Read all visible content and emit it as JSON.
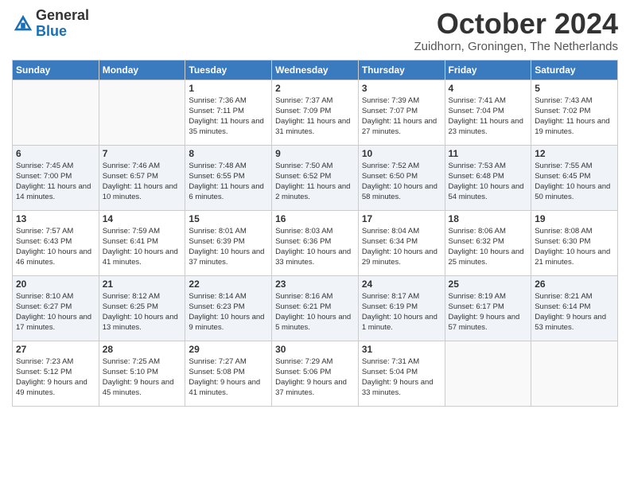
{
  "logo": {
    "general": "General",
    "blue": "Blue"
  },
  "title": "October 2024",
  "subtitle": "Zuidhorn, Groningen, The Netherlands",
  "days_of_week": [
    "Sunday",
    "Monday",
    "Tuesday",
    "Wednesday",
    "Thursday",
    "Friday",
    "Saturday"
  ],
  "weeks": [
    [
      {
        "day": "",
        "info": ""
      },
      {
        "day": "",
        "info": ""
      },
      {
        "day": "1",
        "info": "Sunrise: 7:36 AM\nSunset: 7:11 PM\nDaylight: 11 hours and 35 minutes."
      },
      {
        "day": "2",
        "info": "Sunrise: 7:37 AM\nSunset: 7:09 PM\nDaylight: 11 hours and 31 minutes."
      },
      {
        "day": "3",
        "info": "Sunrise: 7:39 AM\nSunset: 7:07 PM\nDaylight: 11 hours and 27 minutes."
      },
      {
        "day": "4",
        "info": "Sunrise: 7:41 AM\nSunset: 7:04 PM\nDaylight: 11 hours and 23 minutes."
      },
      {
        "day": "5",
        "info": "Sunrise: 7:43 AM\nSunset: 7:02 PM\nDaylight: 11 hours and 19 minutes."
      }
    ],
    [
      {
        "day": "6",
        "info": "Sunrise: 7:45 AM\nSunset: 7:00 PM\nDaylight: 11 hours and 14 minutes."
      },
      {
        "day": "7",
        "info": "Sunrise: 7:46 AM\nSunset: 6:57 PM\nDaylight: 11 hours and 10 minutes."
      },
      {
        "day": "8",
        "info": "Sunrise: 7:48 AM\nSunset: 6:55 PM\nDaylight: 11 hours and 6 minutes."
      },
      {
        "day": "9",
        "info": "Sunrise: 7:50 AM\nSunset: 6:52 PM\nDaylight: 11 hours and 2 minutes."
      },
      {
        "day": "10",
        "info": "Sunrise: 7:52 AM\nSunset: 6:50 PM\nDaylight: 10 hours and 58 minutes."
      },
      {
        "day": "11",
        "info": "Sunrise: 7:53 AM\nSunset: 6:48 PM\nDaylight: 10 hours and 54 minutes."
      },
      {
        "day": "12",
        "info": "Sunrise: 7:55 AM\nSunset: 6:45 PM\nDaylight: 10 hours and 50 minutes."
      }
    ],
    [
      {
        "day": "13",
        "info": "Sunrise: 7:57 AM\nSunset: 6:43 PM\nDaylight: 10 hours and 46 minutes."
      },
      {
        "day": "14",
        "info": "Sunrise: 7:59 AM\nSunset: 6:41 PM\nDaylight: 10 hours and 41 minutes."
      },
      {
        "day": "15",
        "info": "Sunrise: 8:01 AM\nSunset: 6:39 PM\nDaylight: 10 hours and 37 minutes."
      },
      {
        "day": "16",
        "info": "Sunrise: 8:03 AM\nSunset: 6:36 PM\nDaylight: 10 hours and 33 minutes."
      },
      {
        "day": "17",
        "info": "Sunrise: 8:04 AM\nSunset: 6:34 PM\nDaylight: 10 hours and 29 minutes."
      },
      {
        "day": "18",
        "info": "Sunrise: 8:06 AM\nSunset: 6:32 PM\nDaylight: 10 hours and 25 minutes."
      },
      {
        "day": "19",
        "info": "Sunrise: 8:08 AM\nSunset: 6:30 PM\nDaylight: 10 hours and 21 minutes."
      }
    ],
    [
      {
        "day": "20",
        "info": "Sunrise: 8:10 AM\nSunset: 6:27 PM\nDaylight: 10 hours and 17 minutes."
      },
      {
        "day": "21",
        "info": "Sunrise: 8:12 AM\nSunset: 6:25 PM\nDaylight: 10 hours and 13 minutes."
      },
      {
        "day": "22",
        "info": "Sunrise: 8:14 AM\nSunset: 6:23 PM\nDaylight: 10 hours and 9 minutes."
      },
      {
        "day": "23",
        "info": "Sunrise: 8:16 AM\nSunset: 6:21 PM\nDaylight: 10 hours and 5 minutes."
      },
      {
        "day": "24",
        "info": "Sunrise: 8:17 AM\nSunset: 6:19 PM\nDaylight: 10 hours and 1 minute."
      },
      {
        "day": "25",
        "info": "Sunrise: 8:19 AM\nSunset: 6:17 PM\nDaylight: 9 hours and 57 minutes."
      },
      {
        "day": "26",
        "info": "Sunrise: 8:21 AM\nSunset: 6:14 PM\nDaylight: 9 hours and 53 minutes."
      }
    ],
    [
      {
        "day": "27",
        "info": "Sunrise: 7:23 AM\nSunset: 5:12 PM\nDaylight: 9 hours and 49 minutes."
      },
      {
        "day": "28",
        "info": "Sunrise: 7:25 AM\nSunset: 5:10 PM\nDaylight: 9 hours and 45 minutes."
      },
      {
        "day": "29",
        "info": "Sunrise: 7:27 AM\nSunset: 5:08 PM\nDaylight: 9 hours and 41 minutes."
      },
      {
        "day": "30",
        "info": "Sunrise: 7:29 AM\nSunset: 5:06 PM\nDaylight: 9 hours and 37 minutes."
      },
      {
        "day": "31",
        "info": "Sunrise: 7:31 AM\nSunset: 5:04 PM\nDaylight: 9 hours and 33 minutes."
      },
      {
        "day": "",
        "info": ""
      },
      {
        "day": "",
        "info": ""
      }
    ]
  ]
}
